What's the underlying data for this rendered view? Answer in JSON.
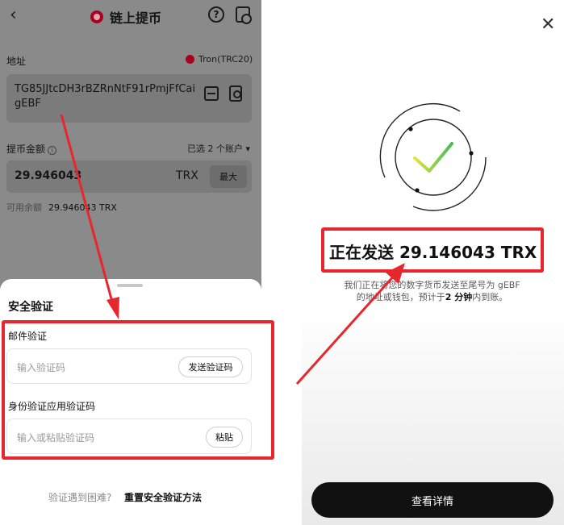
{
  "colors": {
    "annotation_red": "#e8262e",
    "brand_red": "#a8001f",
    "check_green": "#3fbf5a",
    "check_yellow": "#e7e23a",
    "button_dark": "#111111"
  },
  "left": {
    "header": {
      "title": "链上提币",
      "back_icon": "chevron-left-icon",
      "help_icon": "help-icon",
      "history_icon": "history-icon"
    },
    "address": {
      "label": "地址",
      "network": "Tron(TRC20)",
      "value": "TG85JJtcDH3rBZRnNtF91rPmjFfCaigEBF",
      "scan_icon": "scan-icon",
      "book_icon": "address-book-icon"
    },
    "amount": {
      "label": "提币金额",
      "accounts": "已选 2 个账户 ▾",
      "value": "29.946043",
      "currency": "TRX",
      "max_label": "最大",
      "available_label": "可用余额",
      "available_value": "29.946043 TRX"
    },
    "sheet": {
      "title": "安全验证",
      "email_label": "邮件验证",
      "email_placeholder": "输入验证码",
      "send_code_label": "发送验证码",
      "auth_label": "身份验证应用验证码",
      "auth_placeholder": "输入或粘贴验证码",
      "paste_label": "粘贴",
      "trouble_text": "验证遇到困难?",
      "reset_text": "重置安全验证方法"
    }
  },
  "right": {
    "close_icon": "close-icon",
    "status": "正在发送 29.146043 TRX",
    "desc_line1": "我们正在将您的数字货币发送至尾号为 gEBF",
    "desc_line2_pre": "的地址或钱包，预计于",
    "desc_bold": "2 分钟",
    "desc_line2_post": "内到账。",
    "cta_label": "查看详情"
  }
}
